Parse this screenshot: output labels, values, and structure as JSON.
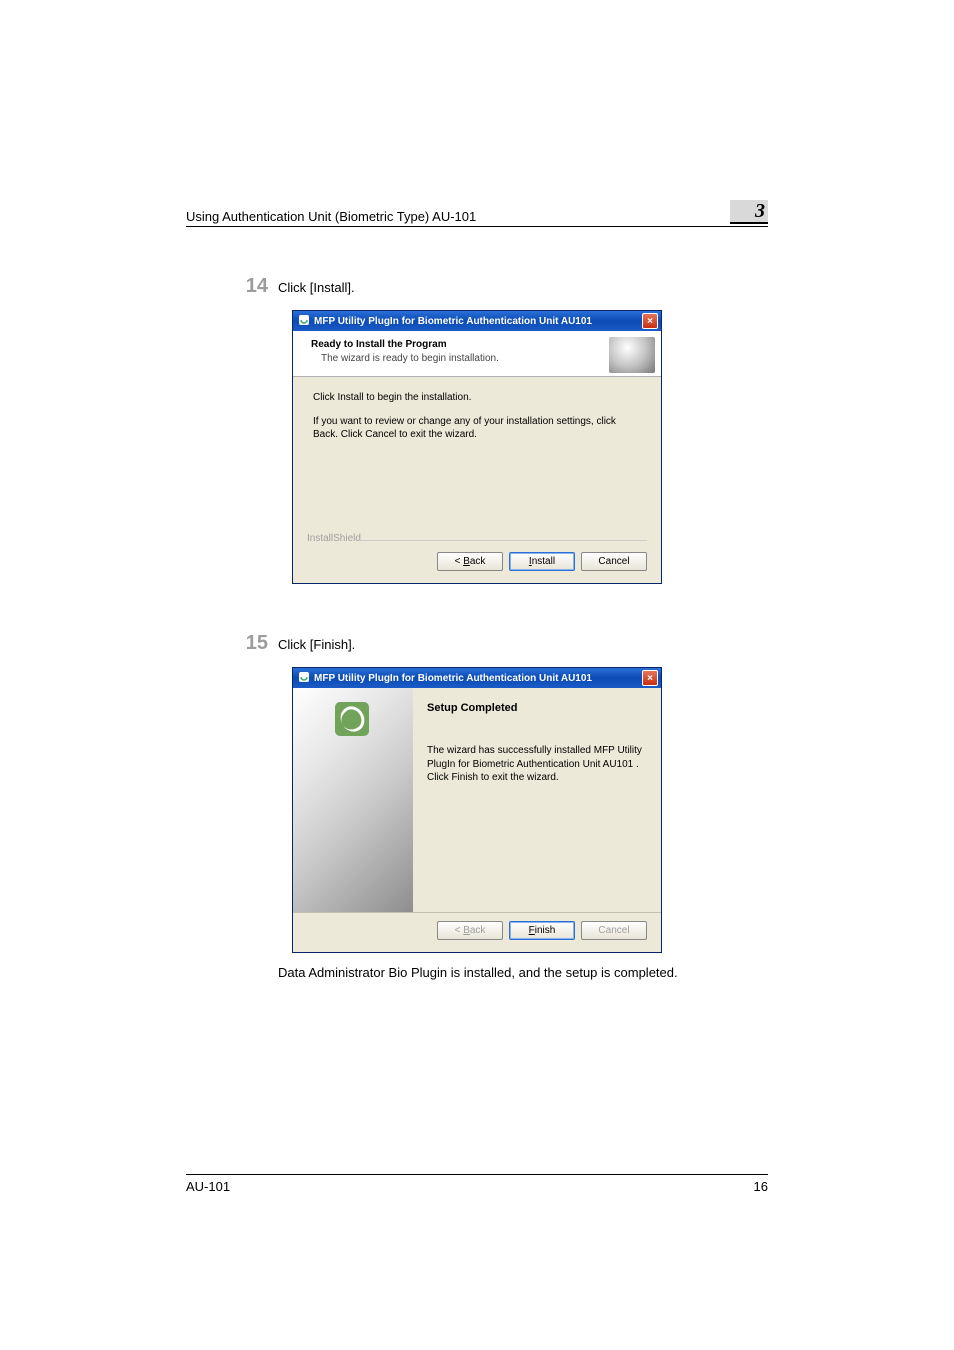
{
  "header": {
    "title": "Using Authentication Unit (Biometric Type) AU-101",
    "chapter": "3"
  },
  "step14": {
    "num": "14",
    "text": "Click [Install]."
  },
  "dlg1": {
    "title": "MFP Utility PlugIn for Biometric Authentication Unit AU101",
    "banner_bold": "Ready to Install the Program",
    "banner_sub": "The wizard is ready to begin installation.",
    "body1": "Click Install to begin the installation.",
    "body2": "If you want to review or change any of your installation settings, click Back. Click Cancel to exit the wizard.",
    "is": "InstallShield",
    "back": "< Back",
    "install": "Install",
    "cancel": "Cancel"
  },
  "step15": {
    "num": "15",
    "text": "Click [Finish]."
  },
  "dlg2": {
    "title": "MFP Utility PlugIn for Biometric Authentication Unit AU101",
    "heading": "Setup Completed",
    "text": "The wizard has successfully installed MFP Utility PlugIn for Biometric Authentication Unit AU101 . Click Finish to exit the wizard.",
    "back": "< Back",
    "finish": "Finish",
    "cancel": "Cancel"
  },
  "after": "Data Administrator Bio Plugin is installed, and the setup is completed.",
  "footer": {
    "left": "AU-101",
    "right": "16"
  }
}
